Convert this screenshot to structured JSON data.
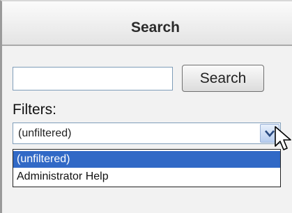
{
  "header": {
    "title": "Search"
  },
  "search": {
    "input_value": "",
    "button_label": "Search"
  },
  "filters": {
    "label": "Filters:",
    "selected_value": "(unfiltered)",
    "options": [
      "(unfiltered)",
      "Administrator Help"
    ],
    "highlighted_index": 0
  },
  "colors": {
    "selection_highlight": "#3169c6",
    "input_border": "#7f9db9"
  },
  "icons": {
    "dropdown_arrow": "chevron-down-icon",
    "cursor": "mouse-pointer-icon"
  }
}
